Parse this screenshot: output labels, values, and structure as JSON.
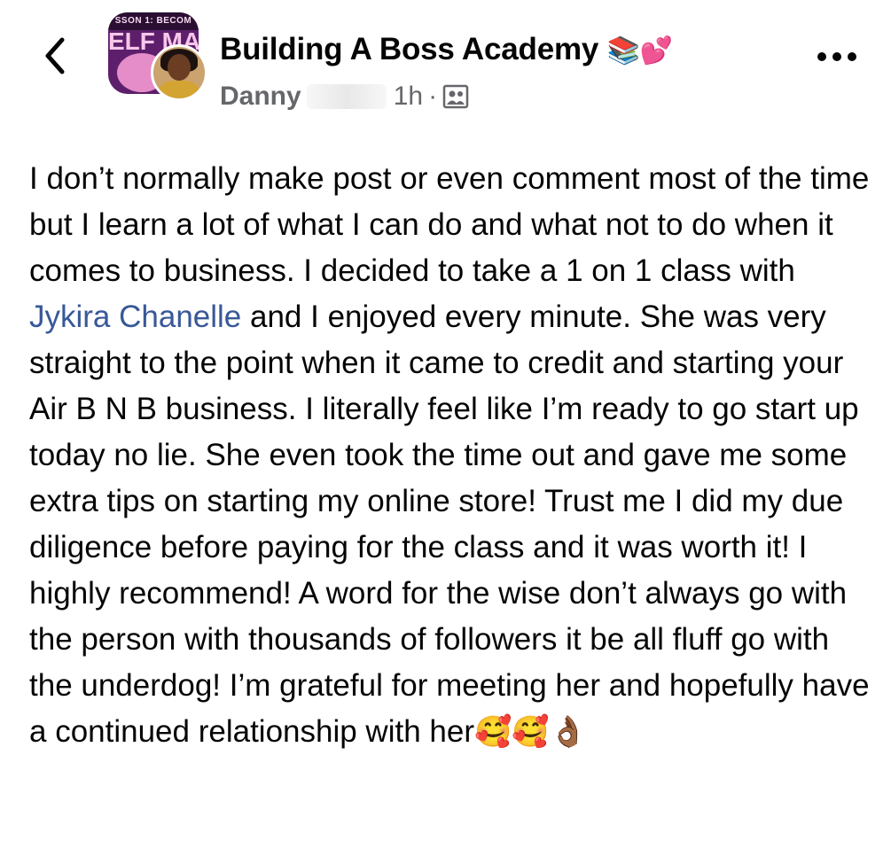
{
  "header": {
    "back_icon": "chevron-left-icon",
    "group_avatar": {
      "band_text": "SSON 1: BECOM",
      "title_text": "ELF MA"
    },
    "group_name": "Building A Boss Academy",
    "group_name_emojis": "📚💕",
    "author": "Danny",
    "time": "1h",
    "separator": "·",
    "privacy_icon": "group-members-icon",
    "more_icon": "more-horizontal-icon"
  },
  "post": {
    "text_part1": "I don’t normally make post or even comment most of the time but I learn a lot of what I can do and what not to do when it comes to business. I decided to take a 1 on 1 class with ",
    "mention": "Jykira Chanelle",
    "text_part2": " and I enjoyed every minute. She was very straight to the point when it came to credit and starting your Air B N B business. I literally feel like I’m ready to go start up today no lie. She even took the time out and gave me some extra tips on starting my online store! Trust me I did my due diligence before paying for the class and it was worth it! I highly recommend! A word for the wise don’t always go with the person with thousands of followers it be all fluff go with the underdog! I’m grateful for meeting her and hopefully have a continued relationship with her",
    "trailing_emojis": "🥰🥰👌🏾"
  },
  "colors": {
    "text": "#050505",
    "secondary": "#65676b",
    "mention": "#385898"
  }
}
